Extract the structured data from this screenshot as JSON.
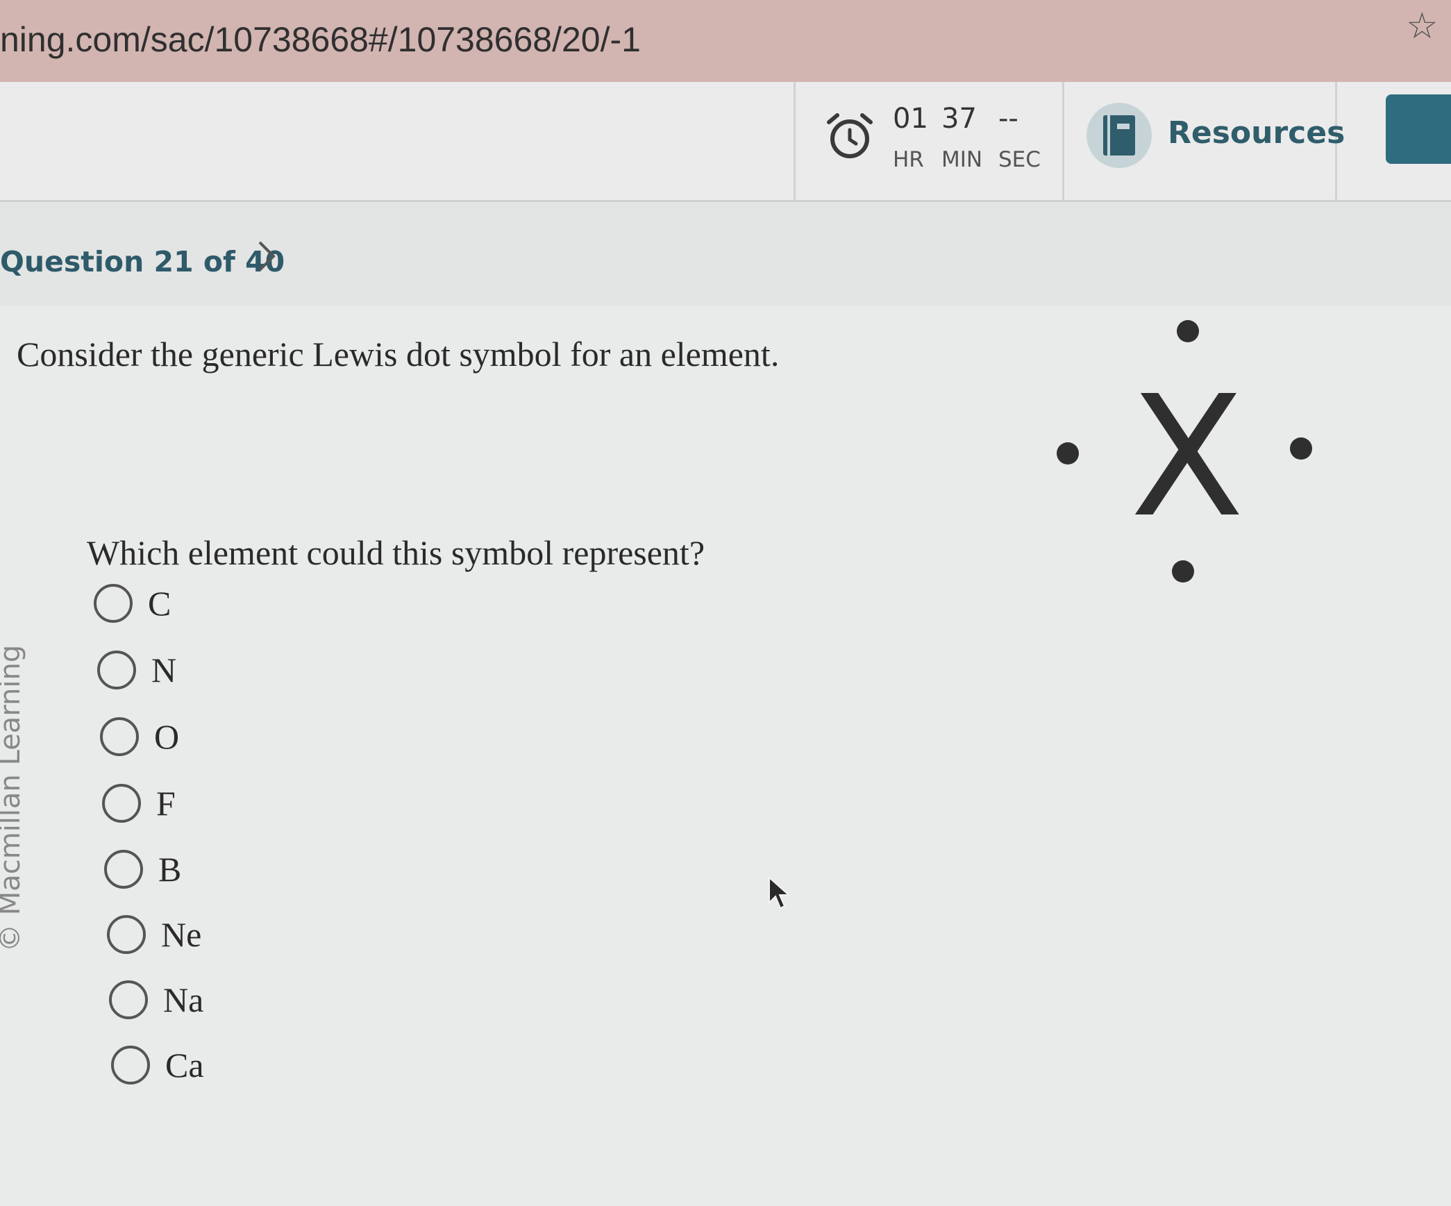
{
  "browser": {
    "url": "ning.com/sac/10738668#/10738668/20/-1",
    "bookmark_icon": "star-icon"
  },
  "timer": {
    "icon": "alarm-clock-icon",
    "hours": "01",
    "minutes": "37",
    "seconds": "--",
    "hours_label": "HR",
    "minutes_label": "MIN",
    "seconds_label": "SEC"
  },
  "resources": {
    "icon": "book-icon",
    "label": "Resources"
  },
  "question_nav": {
    "counter": "Question 21 of 40",
    "next_icon": "chevron-right-icon"
  },
  "watermark": "© Macmillan Learning",
  "question": {
    "prompt": "Consider the generic Lewis dot symbol for an element.",
    "text": "Which element could this symbol represent?",
    "symbol": "X",
    "options": [
      "C",
      "N",
      "O",
      "F",
      "B",
      "Ne",
      "Na",
      "Ca"
    ]
  },
  "colors": {
    "accent": "#2f5d6b",
    "next_button": "#2f6c80",
    "url_bar": "#d2b4b1"
  }
}
